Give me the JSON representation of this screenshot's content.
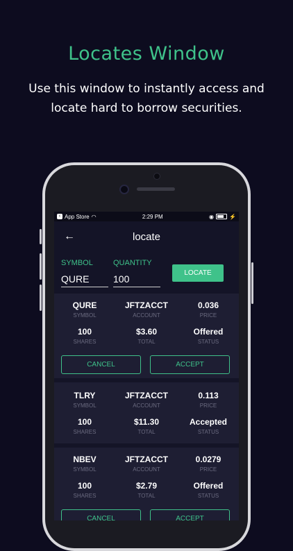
{
  "promo": {
    "headline": "Locates Window",
    "subtext": "Use this window to instantly access and locate hard to borrow securities."
  },
  "status_bar": {
    "back_app": "App Store",
    "time": "2:29 PM"
  },
  "app_bar": {
    "title": "locate"
  },
  "form": {
    "symbol_label": "SYMBOL",
    "symbol_value": "QURE",
    "quantity_label": "QUANTITY",
    "quantity_value": "100",
    "locate_label": "LOCATE"
  },
  "labels": {
    "symbol": "SYMBOL",
    "account": "ACCOUNT",
    "price": "PRICE",
    "shares": "SHARES",
    "total": "TOTAL",
    "status": "STATUS",
    "cancel": "CANCEL",
    "accept": "ACCEPT"
  },
  "results": [
    {
      "symbol": "QURE",
      "account": "JFTZACCT",
      "price": "0.036",
      "shares": "100",
      "total": "$3.60",
      "status": "Offered"
    },
    {
      "symbol": "TLRY",
      "account": "JFTZACCT",
      "price": "0.113",
      "shares": "100",
      "total": "$11.30",
      "status": "Accepted"
    },
    {
      "symbol": "NBEV",
      "account": "JFTZACCT",
      "price": "0.0279",
      "shares": "100",
      "total": "$2.79",
      "status": "Offered"
    }
  ]
}
